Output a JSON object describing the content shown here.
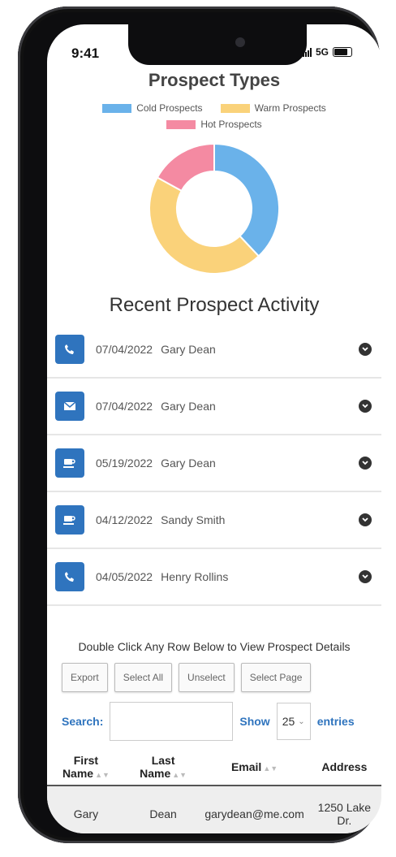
{
  "status_bar": {
    "time": "9:41",
    "network": "5G"
  },
  "prospect_types": {
    "title": "Prospect Types",
    "chart_data": {
      "type": "pie",
      "title": "Prospect Types",
      "categories": [
        "Cold Prospects",
        "Warm Prospects",
        "Hot Prospects"
      ],
      "values": [
        38,
        45,
        17
      ],
      "colors": [
        "#6ab2ea",
        "#fad27a",
        "#f48aa2"
      ],
      "donut": true,
      "legend_position": "top"
    }
  },
  "activity": {
    "title": "Recent Prospect Activity",
    "items": [
      {
        "icon": "phone-icon",
        "date": "07/04/2022",
        "name": "Gary Dean"
      },
      {
        "icon": "envelope-icon",
        "date": "07/04/2022",
        "name": "Gary Dean"
      },
      {
        "icon": "coffee-icon",
        "date": "05/19/2022",
        "name": "Gary Dean"
      },
      {
        "icon": "coffee-icon",
        "date": "04/12/2022",
        "name": "Sandy Smith"
      },
      {
        "icon": "phone-icon",
        "date": "04/05/2022",
        "name": "Henry Rollins"
      }
    ]
  },
  "table_section": {
    "instruction": "Double Click Any Row Below to View Prospect Details",
    "buttons": {
      "export": "Export",
      "select_all": "Select All",
      "unselect": "Unselect",
      "select_page": "Select Page"
    },
    "search_label": "Search:",
    "search_value": "",
    "show_label": "Show",
    "entries_value": "25",
    "entries_label": "entries",
    "headers": {
      "first_name": "First Name",
      "last_name": "Last Name",
      "email": "Email",
      "address": "Address"
    },
    "rows": [
      {
        "first": "Gary",
        "last": "Dean",
        "email": "garydean@me.com",
        "address": "1250 Lake Dr."
      }
    ]
  },
  "colors": {
    "accent": "#2f74be",
    "cold": "#6ab2ea",
    "warm": "#fad27a",
    "hot": "#f48aa2"
  }
}
